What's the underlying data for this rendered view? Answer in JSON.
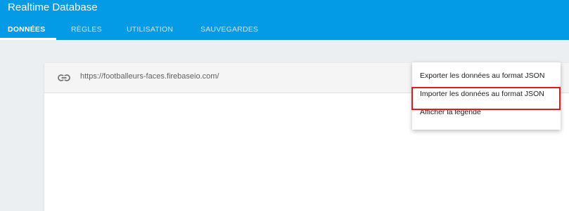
{
  "header": {
    "title": "Realtime Database",
    "tabs": [
      {
        "label": "DONNÉES",
        "active": true
      },
      {
        "label": "RÈGLES",
        "active": false
      },
      {
        "label": "UTILISATION",
        "active": false
      },
      {
        "label": "SAUVEGARDES",
        "active": false
      }
    ]
  },
  "database": {
    "url": "https://footballeurs-faces.firebaseio.com/",
    "url_icon": "link-icon"
  },
  "menu": {
    "items": [
      {
        "label": "Exporter les données au format JSON"
      },
      {
        "label": "Importer les données au format JSON",
        "highlighted": true
      },
      {
        "label": "Afficher la légende"
      }
    ]
  },
  "colors": {
    "header_bg": "#039be5",
    "page_bg": "#eceff1",
    "highlight_border": "#e01b1b"
  }
}
